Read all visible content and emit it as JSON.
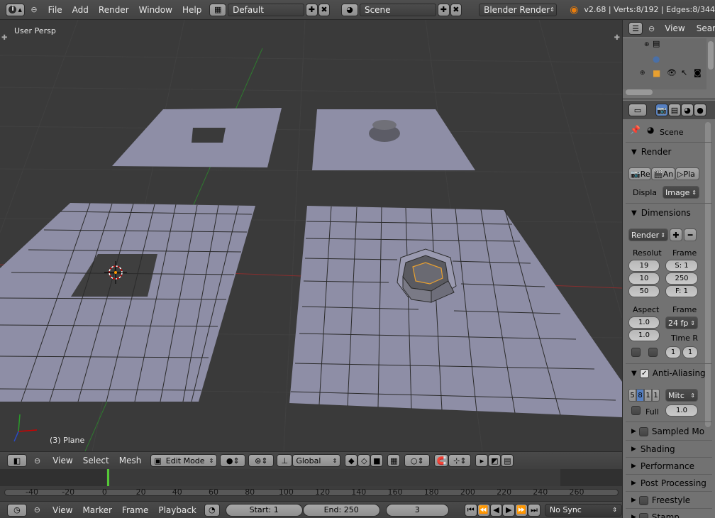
{
  "topbar": {
    "menus": [
      "File",
      "Add",
      "Render",
      "Window",
      "Help"
    ],
    "layout_name": "Default",
    "scene_name": "Scene",
    "engine": "Blender Render",
    "stats": "v2.68 | Verts:8/192 | Edges:8/344"
  },
  "viewport": {
    "view_label": "User Persp",
    "object_label": "(3) Plane",
    "header": {
      "menus": [
        "View",
        "Select",
        "Mesh"
      ],
      "mode": "Edit Mode",
      "orientation": "Global"
    }
  },
  "timeline": {
    "ticks": [
      "-40",
      "-20",
      "0",
      "20",
      "40",
      "60",
      "80",
      "100",
      "120",
      "140",
      "160",
      "180",
      "200",
      "220",
      "240",
      "260"
    ],
    "current_frame_marker": 0,
    "header": {
      "menus": [
        "View",
        "Marker",
        "Frame",
        "Playback"
      ],
      "start": "Start: 1",
      "end": "End: 250",
      "current": "3",
      "sync": "No Sync"
    }
  },
  "outliner": {
    "view_menu": "View",
    "search": "Sear"
  },
  "properties": {
    "scene_label": "Scene",
    "render_panel": {
      "title": "Render",
      "render_btn": "Re",
      "anim_btn": "An",
      "play_btn": "Pla",
      "display_label": "Displa",
      "display_value": "Image"
    },
    "dimensions_panel": {
      "title": "Dimensions",
      "preset": "Render",
      "resolution_label": "Resolut",
      "res_x": "19",
      "res_y": "10",
      "res_pct": "50",
      "frame_label": "Frame",
      "frame_start": "S: 1",
      "frame_end": "250",
      "frame_step": "F: 1",
      "aspect_label": "Aspect",
      "aspect_x": "1.0",
      "aspect_y": "1.0",
      "framerate_label": "Frame",
      "framerate": "24 fp",
      "time_remap_label": "Time R",
      "time_old": "1",
      "time_new": "1"
    },
    "aa_panel": {
      "title": "Anti-Aliasing",
      "samples": [
        "5",
        "8",
        "1",
        "1"
      ],
      "filter": "Mitc",
      "full_label": "Full",
      "filter_size": "1.0"
    },
    "collapsed_panels": [
      "Sampled Mo",
      "Shading",
      "Performance",
      "Post Processing",
      "Freestyle",
      "Stamp"
    ]
  }
}
